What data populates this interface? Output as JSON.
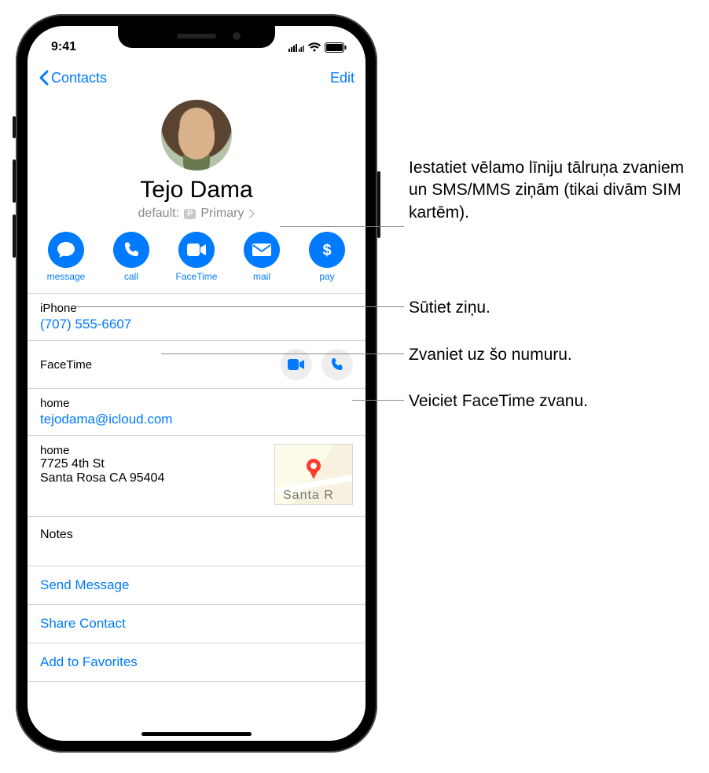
{
  "status": {
    "time": "9:41"
  },
  "nav": {
    "back": "Contacts",
    "edit": "Edit"
  },
  "contact": {
    "name": "Tejo Dama",
    "sim_default_label": "default:",
    "sim_badge": "P",
    "sim_line": "Primary"
  },
  "actions": {
    "message": "message",
    "call": "call",
    "facetime": "FaceTime",
    "mail": "mail",
    "pay": "pay"
  },
  "phone": {
    "label": "iPhone",
    "number": "(707) 555-6607"
  },
  "facetime": {
    "label": "FaceTime"
  },
  "email": {
    "label": "home",
    "value": "tejodama@icloud.com"
  },
  "address": {
    "label": "home",
    "line1": "7725 4th St",
    "line2": "Santa Rosa CA 95404",
    "map_city": "Santa R"
  },
  "notes": {
    "label": "Notes"
  },
  "links": {
    "send_message": "Send Message",
    "share_contact": "Share Contact",
    "add_favorites": "Add to Favorites"
  },
  "callouts": {
    "sim": "Iestatiet vēlamo līniju tālruņa zvaniem un SMS/MMS ziņām (tikai divām SIM kartēm).",
    "message": "Sūtiet ziņu.",
    "call_number": "Zvaniet uz šo numuru.",
    "facetime_call": "Veiciet FaceTime zvanu."
  }
}
